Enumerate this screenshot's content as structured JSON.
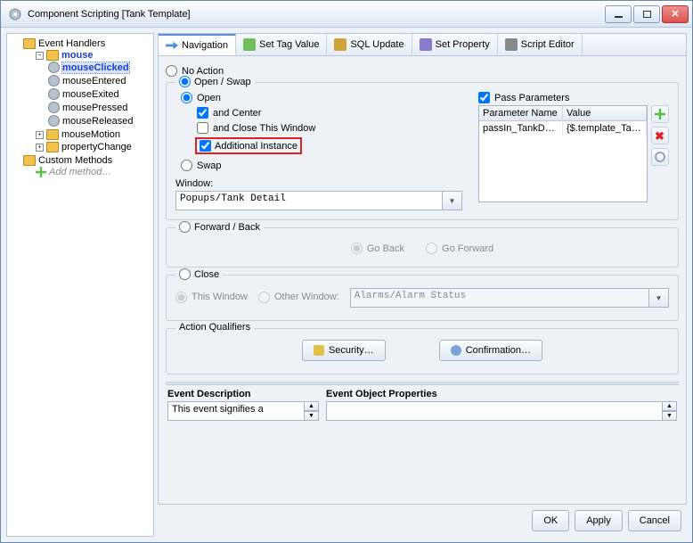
{
  "window": {
    "title": "Component Scripting [Tank Template]"
  },
  "tree": {
    "root": "Event Handlers",
    "mouse": "mouse",
    "mouseClicked": "mouseClicked",
    "mouseEntered": "mouseEntered",
    "mouseExited": "mouseExited",
    "mousePressed": "mousePressed",
    "mouseReleased": "mouseReleased",
    "mouseMotion": "mouseMotion",
    "propertyChange": "propertyChange",
    "customMethods": "Custom Methods",
    "addMethod": "Add method…"
  },
  "tabs": {
    "navigation": "Navigation",
    "setTagValue": "Set Tag Value",
    "sqlUpdate": "SQL Update",
    "setProperty": "Set Property",
    "scriptEditor": "Script Editor"
  },
  "nav": {
    "noAction": "No Action",
    "openSwap": "Open / Swap",
    "open": "Open",
    "andCenter": "and Center",
    "andClose": "and Close This Window",
    "additionalInstance": "Additional Instance",
    "swap": "Swap",
    "windowLabel": "Window:",
    "windowValue": "Popups/Tank Detail",
    "passParams": "Pass Parameters",
    "paramHeaderName": "Parameter Name",
    "paramHeaderValue": "Value",
    "paramRowName": "passIn_TankD…",
    "paramRowValue": "{$.template_Ta…",
    "forwardBack": "Forward / Back",
    "goBack": "Go Back",
    "goForward": "Go Forward",
    "close": "Close",
    "thisWindow": "This Window",
    "otherWindow": "Other Window:",
    "otherWindowValue": "Alarms/Alarm Status",
    "actionQualifiers": "Action Qualifiers",
    "security": "Security…",
    "confirmation": "Confirmation…"
  },
  "desc": {
    "eventDescription": "Event Description",
    "eventObjectProperties": "Event Object Properties",
    "eventDescText": "This event signifies a"
  },
  "buttons": {
    "ok": "OK",
    "apply": "Apply",
    "cancel": "Cancel"
  }
}
